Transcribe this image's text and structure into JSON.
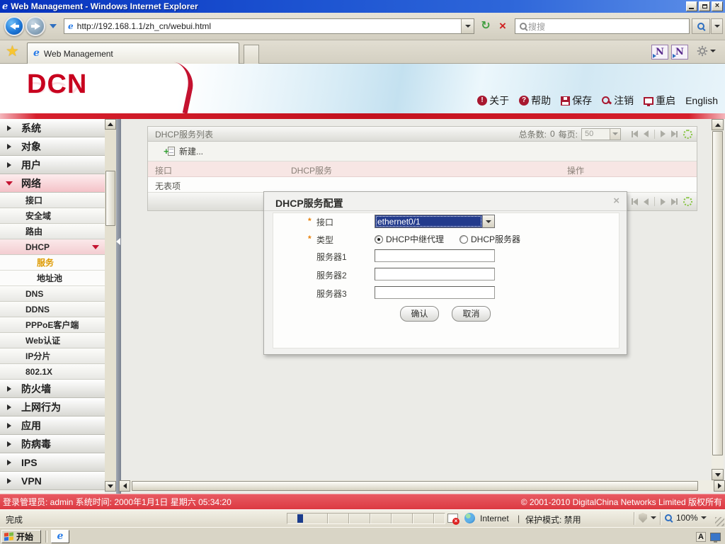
{
  "window": {
    "title": "Web Management - Windows Internet Explorer"
  },
  "browser": {
    "url": "http://192.168.1.1/zh_cn/webui.html",
    "search_placeholder": "搜搜",
    "tab_title": "Web Management",
    "status_done": "完成",
    "zone_label": "Internet",
    "zone_divider": "|",
    "protected_mode": "保护模式: 禁用",
    "zoom_level": "100%"
  },
  "header": {
    "logo_text": "DCN",
    "links": [
      {
        "label": "关于",
        "icon": "about-icon",
        "glyph": "!"
      },
      {
        "label": "帮助",
        "icon": "help-icon",
        "glyph": "?"
      },
      {
        "label": "保存",
        "icon": "save-icon"
      },
      {
        "label": "注销",
        "icon": "logout-icon"
      },
      {
        "label": "重启",
        "icon": "reboot-icon"
      },
      {
        "label": "English"
      }
    ]
  },
  "sidebar": {
    "items": [
      {
        "label": "系统"
      },
      {
        "label": "对象"
      },
      {
        "label": "用户"
      },
      {
        "label": "网络"
      },
      {
        "label": "接口"
      },
      {
        "label": "安全域"
      },
      {
        "label": "路由"
      },
      {
        "label": "DHCP"
      },
      {
        "label": "服务"
      },
      {
        "label": "地址池"
      },
      {
        "label": "DNS"
      },
      {
        "label": "DDNS"
      },
      {
        "label": "PPPoE客户端"
      },
      {
        "label": "Web认证"
      },
      {
        "label": "IP分片"
      },
      {
        "label": "802.1X"
      },
      {
        "label": "防火墙"
      },
      {
        "label": "上网行为"
      },
      {
        "label": "应用"
      },
      {
        "label": "防病毒"
      },
      {
        "label": "IPS"
      },
      {
        "label": "VPN"
      }
    ]
  },
  "panel": {
    "title": "DHCP服务列表",
    "total_label": "总条数:",
    "total_value": "0",
    "per_page_label": "每页:",
    "page_size": "50",
    "new_label": "新建...",
    "columns": [
      "接口",
      "DHCP服务",
      "操作"
    ],
    "empty_text": "无表项"
  },
  "dialog": {
    "title": "DHCP服务配置",
    "close_glyph": "×",
    "required_marker": "*",
    "interface_label": "接口",
    "interface_value": "ethernet0/1",
    "type_label": "类型",
    "radio_relay": "DHCP中继代理",
    "radio_server": "DHCP服务器",
    "server1_label": "服务器1",
    "server2_label": "服务器2",
    "server3_label": "服务器3",
    "confirm_label": "确认",
    "cancel_label": "取消"
  },
  "footer": {
    "admin_info": "登录管理员: admin 系统时间: 2000年1月1日 星期六 05:34:20",
    "copyright": "© 2001-2010 DigitalChina Networks Limited 版权所有"
  },
  "taskbar": {
    "start_label": "开始",
    "tray_lang": "A"
  },
  "colors": {
    "brand_red": "#C8102E",
    "selected_item_orange": "#DE9A00",
    "select_highlight_navy": "#233B8C",
    "footer_red": "#E04249"
  }
}
